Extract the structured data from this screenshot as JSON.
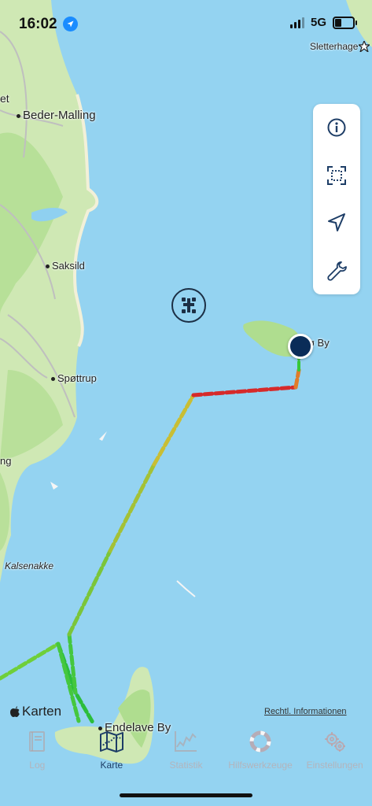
{
  "status_bar": {
    "time": "16:02",
    "network": "5G",
    "signal_bars": 3
  },
  "map_labels": {
    "sletterhage": "Sletterhage",
    "et": "et",
    "beder_malling": "Beder-Malling",
    "saksild": "Saksild",
    "spottrup": "Spøttrup",
    "ng": "ng",
    "kalsenakke": "Kalsenakke",
    "island_town": "ø By",
    "endelave_by": "Endelave By"
  },
  "map_footer": {
    "apple_maps": "Karten",
    "legal": "Rechtl. Informationen"
  },
  "map_controls": [
    "info-icon",
    "focus-region-icon",
    "navigation-arrow-icon",
    "wrench-icon"
  ],
  "tabs": [
    {
      "label": "Log",
      "icon": "logbook-icon",
      "active": false
    },
    {
      "label": "Karte",
      "icon": "map-icon",
      "active": true
    },
    {
      "label": "Statistik",
      "icon": "chart-icon",
      "active": false
    },
    {
      "label": "Hilfswerkzeuge",
      "icon": "lifebuoy-icon",
      "active": false
    },
    {
      "label": "Einstellungen",
      "icon": "gears-icon",
      "active": false
    }
  ],
  "colors": {
    "sea": "#8fd0f0",
    "land": "#cfe8b4",
    "forest": "#a9d98c",
    "track_slow": "#37c837",
    "track_medium": "#c8b432",
    "track_fast": "#d62a2a",
    "active_tab": "#1d3d66"
  }
}
